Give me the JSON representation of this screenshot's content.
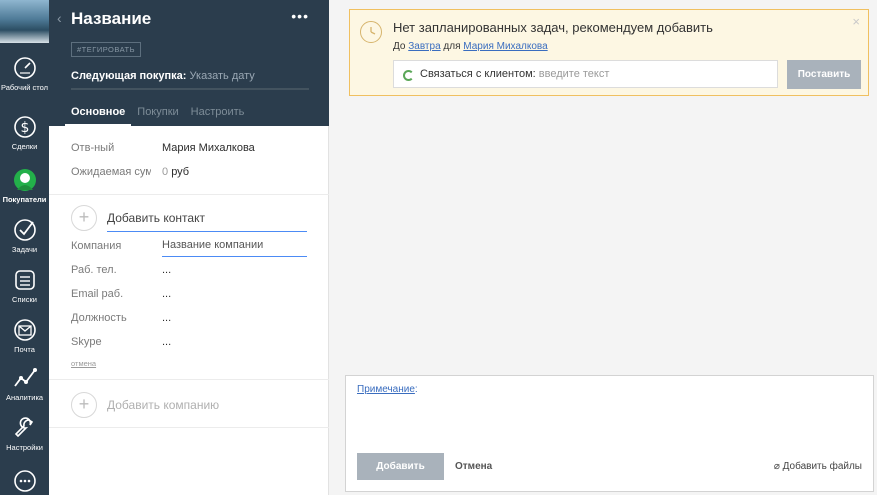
{
  "nav": {
    "items": [
      {
        "label": "Рабочий стол",
        "icon": "dashboard-icon"
      },
      {
        "label": "Сделки",
        "icon": "dollar-icon"
      },
      {
        "label": "Покупатели",
        "icon": "customers-icon"
      },
      {
        "label": "Задачи",
        "icon": "check-icon"
      },
      {
        "label": "Списки",
        "icon": "lists-icon"
      },
      {
        "label": "Почта",
        "icon": "mail-icon"
      },
      {
        "label": "Аналитика",
        "icon": "analytics-icon"
      },
      {
        "label": "Настройки",
        "icon": "wrench-icon"
      }
    ]
  },
  "card": {
    "title": "Название",
    "tag_button": "#ТЕГИРОВАТЬ",
    "next_purchase_label": "Следующая покупка:",
    "next_purchase_value": "Указать дату",
    "tabs": [
      "Основное",
      "Покупки",
      "Настроить"
    ],
    "fields": {
      "responsible_label": "Отв-ный",
      "responsible_value": "Мария Михалкова",
      "expected_sum_label": "Ожидаемая сумм",
      "expected_sum_value": "0",
      "currency": "руб"
    },
    "contact": {
      "add_contact": "Добавить контакт",
      "company_label": "Компания",
      "company_placeholder": "Название компании",
      "work_phone_label": "Раб. тел.",
      "work_email_label": "Email раб.",
      "position_label": "Должность",
      "skype_label": "Skype",
      "empty_value": "...",
      "cancel": "отмена"
    },
    "add_company": "Добавить компанию"
  },
  "task": {
    "title": "Нет запланированных задач, рекомендуем добавить",
    "due_prefix": "До",
    "due_link": "Завтра",
    "for_word": "для",
    "user_link": "Мария Михалкова",
    "type_label": "Связаться с клиентом:",
    "input_placeholder": "введите текст",
    "submit": "Поставить",
    "close": "×"
  },
  "note": {
    "label": "Примечание",
    "colon": ":",
    "add_button": "Добавить",
    "cancel_button": "Отмена",
    "attach": "Добавить файлы"
  }
}
